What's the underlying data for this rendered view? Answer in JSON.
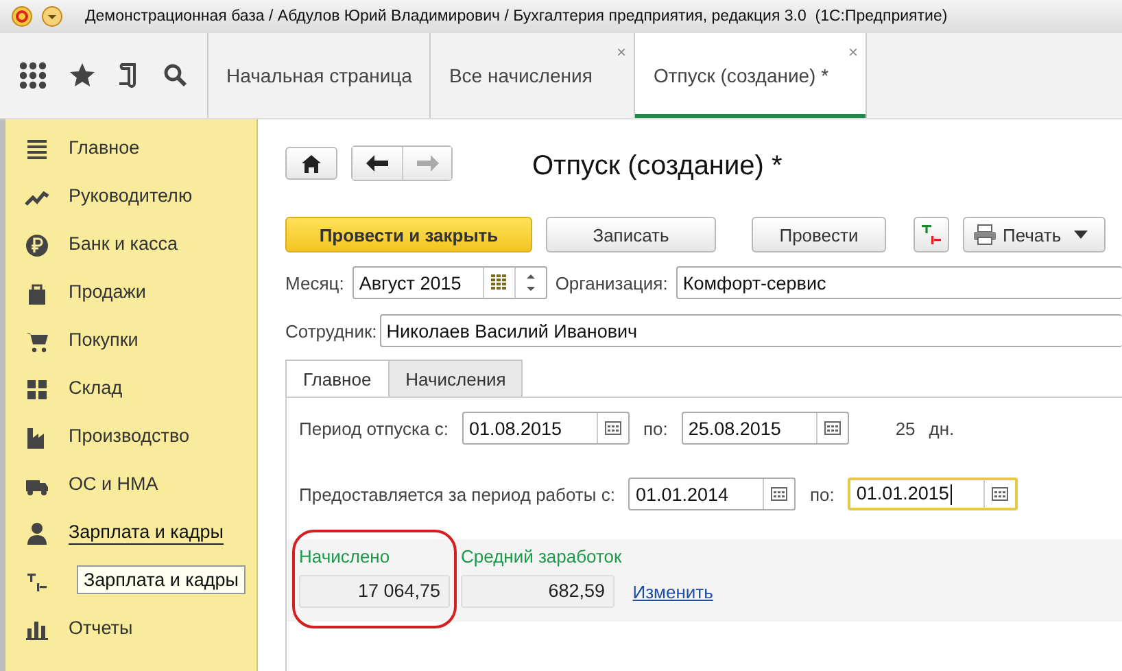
{
  "window": {
    "title": "Демонстрационная база / Абдулов Юрий Владимирович / Бухгалтерия предприятия, редакция 3.0  (1С:Предприятие)"
  },
  "tabs": [
    {
      "label": "Начальная страница",
      "selected": false
    },
    {
      "label": "Все начисления",
      "selected": false,
      "close": "×"
    },
    {
      "label": "Отпуск (создание) *",
      "selected": true,
      "close": "×"
    }
  ],
  "sidebar": {
    "items": [
      {
        "label": "Главное",
        "hovered": false
      },
      {
        "label": "Руководителю",
        "hovered": false
      },
      {
        "label": "Банк и касса",
        "hovered": false
      },
      {
        "label": "Продажи",
        "hovered": false
      },
      {
        "label": "Покупки",
        "hovered": false
      },
      {
        "label": "Склад",
        "hovered": false
      },
      {
        "label": "Производство",
        "hovered": false
      },
      {
        "label": "ОС и НМА",
        "hovered": false
      },
      {
        "label": "Зарплата и кадры",
        "hovered": true
      },
      {
        "tooltip": "Зарплата и кадры"
      },
      {
        "label": "Отчеты",
        "hovered": false
      }
    ]
  },
  "form": {
    "title": "Отпуск (создание) *",
    "buttons": [
      {
        "label": "Провести и закрыть",
        "kind": "primary"
      },
      {
        "label": "Записать",
        "kind": "plain"
      },
      {
        "label": "Провести",
        "kind": "plain"
      }
    ],
    "print_button": "Печать",
    "month": {
      "label": "Месяц:",
      "value": "Август 2015"
    },
    "organization": {
      "label": "Организация:",
      "value": "Комфорт-сервис"
    },
    "employee": {
      "label": "Сотрудник:",
      "value": "Николаев Василий Иванович"
    },
    "tabs": [
      {
        "label": "Главное",
        "selected": true
      },
      {
        "label": "Начисления",
        "selected": false
      }
    ],
    "vacation": {
      "label": "Период отпуска с:",
      "from": "01.08.2015",
      "to_label": "по:",
      "to": "25.08.2015",
      "days": "25",
      "days_unit": "дн."
    },
    "work_period": {
      "label": "Предоставляется за период работы с:",
      "from": "01.01.2014",
      "to_label": "по:",
      "to": "01.01.2015"
    },
    "accrued": {
      "label": "Начислено",
      "value": "17 064,75",
      "circled": true
    },
    "average": {
      "label": "Средний заработок",
      "value": "682,59"
    },
    "change_link": "Изменить"
  }
}
